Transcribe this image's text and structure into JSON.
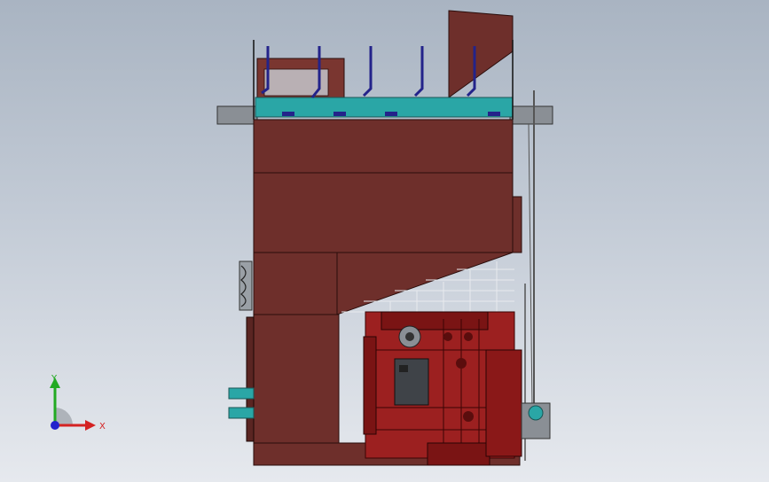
{
  "scene": {
    "background_top": "#a9b4c2",
    "background_bottom": "#e6e9ee",
    "colors": {
      "frame_red": "#6e2f2b",
      "frame_red_dark": "#4a1c1a",
      "engine_red": "#9c2020",
      "teal_rail": "#2aa6a6",
      "blue_post": "#23238a",
      "steel_gray": "#8a8f95"
    }
  },
  "triad": {
    "x_label": "X",
    "y_label": "Y",
    "x_color": "#d42222",
    "y_color": "#22aa22",
    "z_color": "#2222cc"
  }
}
